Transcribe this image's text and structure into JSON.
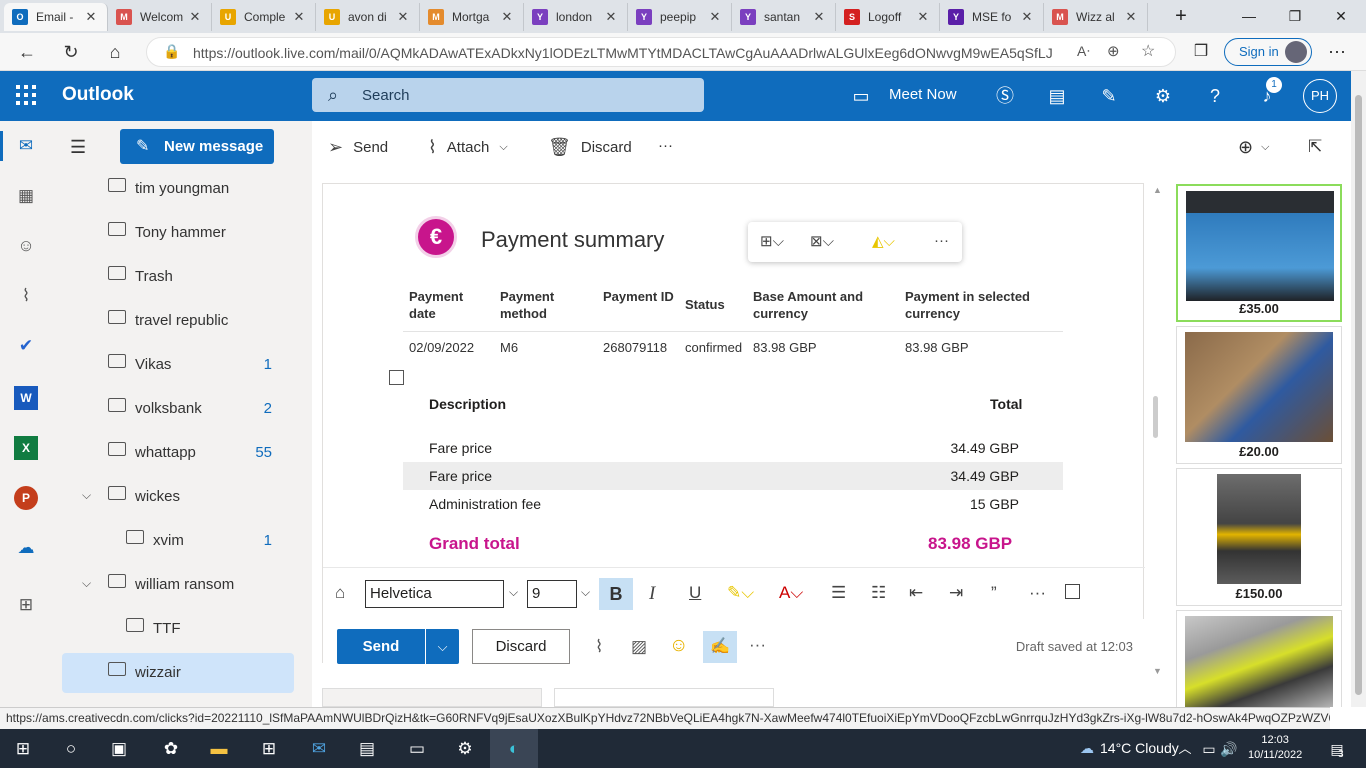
{
  "browser": {
    "tabs": [
      {
        "label": "Email -",
        "color": "#0f6cbd",
        "glyph": "O"
      },
      {
        "label": "Welcom",
        "color": "#d9534f",
        "glyph": "M"
      },
      {
        "label": "Comple",
        "color": "#e8a500",
        "glyph": "U"
      },
      {
        "label": "avon di",
        "color": "#e8a500",
        "glyph": "U"
      },
      {
        "label": "Mortga",
        "color": "#e48b2d",
        "glyph": "M"
      },
      {
        "label": "london",
        "color": "#7b3fbf",
        "glyph": "Y"
      },
      {
        "label": "peepip",
        "color": "#7b3fbf",
        "glyph": "Y"
      },
      {
        "label": "santan",
        "color": "#7b3fbf",
        "glyph": "Y"
      },
      {
        "label": "Logoff",
        "color": "#d42020",
        "glyph": "S"
      },
      {
        "label": "MSE fo",
        "color": "#5a1fa8",
        "glyph": "Y"
      },
      {
        "label": "Wizz al",
        "color": "#d9534f",
        "glyph": "M"
      }
    ],
    "new_tab": "+",
    "url": "https://outlook.live.com/mail/0/AQMkADAwATExADkxNy1lODEzLTMwMTYtMDACLTAwCgAuAAADrlwALGUlxEeg6dONwvgM9wEA5qSfLJ5...",
    "signin_label": "Sign in"
  },
  "outlook": {
    "brand": "Outlook",
    "search_placeholder": "Search",
    "meet_now": "Meet Now",
    "notif_count": "1",
    "user_initials": "PH",
    "new_message": "New message",
    "folders": [
      {
        "name": "tim youngman",
        "count": "",
        "indent": 0,
        "chevron": ""
      },
      {
        "name": "Tony hammer",
        "count": "",
        "indent": 0,
        "chevron": ""
      },
      {
        "name": "Trash",
        "count": "",
        "indent": 0,
        "chevron": ""
      },
      {
        "name": "travel republic",
        "count": "",
        "indent": 0,
        "chevron": ""
      },
      {
        "name": "Vikas",
        "count": "1",
        "indent": 0,
        "chevron": ""
      },
      {
        "name": "volksbank",
        "count": "2",
        "indent": 0,
        "chevron": ""
      },
      {
        "name": "whattapp",
        "count": "55",
        "indent": 0,
        "chevron": ""
      },
      {
        "name": "wickes",
        "count": "",
        "indent": 0,
        "chevron": "⌵"
      },
      {
        "name": "xvim",
        "count": "1",
        "indent": 1,
        "chevron": ""
      },
      {
        "name": "william ransom",
        "count": "",
        "indent": 0,
        "chevron": "⌵"
      },
      {
        "name": "TTF",
        "count": "",
        "indent": 1,
        "chevron": ""
      },
      {
        "name": "wizzair",
        "count": "",
        "indent": 0,
        "chevron": ""
      }
    ],
    "toolbar": {
      "send": "Send",
      "attach": "Attach",
      "discard": "Discard",
      "more": "···"
    }
  },
  "email": {
    "title": "Payment summary",
    "euro_glyph": "€",
    "headers": [
      "Payment date",
      "Payment method",
      "Payment ID",
      "Status",
      "Base Amount and currency",
      "Payment in selected currency"
    ],
    "row": [
      "02/09/2022",
      "M6",
      "268079118",
      "confirmed",
      "83.98 GBP",
      "83.98 GBP"
    ],
    "desc_header": "Description",
    "total_header": "Total",
    "lines": [
      {
        "name": "Fare price",
        "value": "34.49  GBP"
      },
      {
        "name": "Fare price",
        "value": "34.49  GBP"
      },
      {
        "name": "Administration fee",
        "value": "15  GBP"
      }
    ],
    "grand_label": "Grand total",
    "grand_value": "83.98  GBP"
  },
  "compose": {
    "font": "Helvetica",
    "size": "9",
    "send": "Send",
    "discard": "Discard",
    "draft_saved": "Draft saved at 12:03"
  },
  "ads": [
    {
      "price": "£35.00"
    },
    {
      "price": "£20.00"
    },
    {
      "price": "£150.00"
    },
    {
      "price": ""
    }
  ],
  "status_url": "https://ams.creativecdn.com/clicks?id=20221110_lSfMaPAAmNWUlBDrQizH&tk=G60RNFVq9jEsaUXozXBulKpYHdvz72NBbVeQLiEA4hgk7N-XawMeefw474l0TEfuoiXiEpYmVDooQFzcbLwGnrrquJzHYd3gkZrs-iXg-lW8u7d2-hOswAk4PwqOZPzWZV6RJR...",
  "taskbar": {
    "weather": "14°C  Cloudy",
    "time": "12:03",
    "date": "10/11/2022",
    "notif": "3"
  }
}
